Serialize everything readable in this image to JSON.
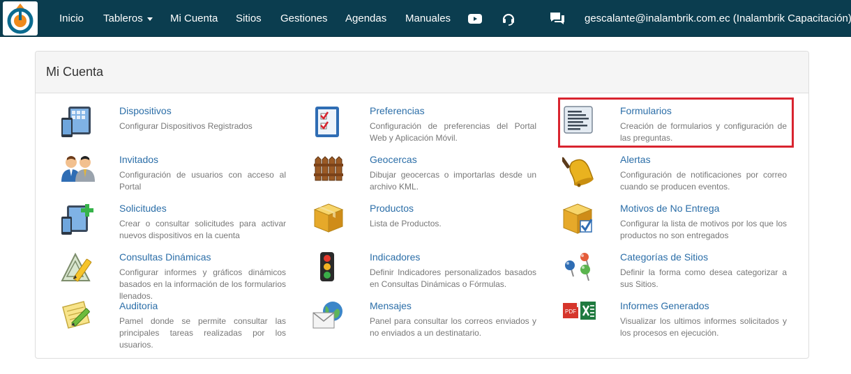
{
  "navbar": {
    "items": [
      {
        "label": "Inicio"
      },
      {
        "label": "Tableros"
      },
      {
        "label": "Mi Cuenta"
      },
      {
        "label": "Sitios"
      },
      {
        "label": "Gestiones"
      },
      {
        "label": "Agendas"
      },
      {
        "label": "Manuales"
      }
    ],
    "user_menu": "gescalante@inalambrik.com.ec (Inalambrik Capacitación)",
    "icons": [
      "youtube-icon",
      "headset-icon",
      "chat-icon"
    ]
  },
  "panel": {
    "title": "Mi Cuenta",
    "highlighted_item": "Formularios",
    "items": [
      {
        "title": "Dispositivos",
        "desc": "Configurar Dispositivos Registrados",
        "icon": "devices-icon"
      },
      {
        "title": "Preferencias",
        "desc": "Configuración de preferencias del Portal Web y Aplicación Móvil.",
        "icon": "checklist-icon"
      },
      {
        "title": "Formularios",
        "desc": "Creación de formularios y configuración de las preguntas.",
        "icon": "form-icon"
      },
      {
        "title": "Invitados",
        "desc": "Configuración de usuarios con acceso al Portal",
        "icon": "users-icon"
      },
      {
        "title": "Geocercas",
        "desc": "Dibujar geocercas o importarlas desde un archivo KML.",
        "icon": "fence-icon"
      },
      {
        "title": "Alertas",
        "desc": "Configuración de notificaciones por correo cuando se producen eventos.",
        "icon": "bell-icon"
      },
      {
        "title": "Solicitudes",
        "desc": "Crear o consultar solicitudes para activar nuevos dispositivos en la cuenta",
        "icon": "add-device-icon"
      },
      {
        "title": "Productos",
        "desc": "Lista de Productos.",
        "icon": "box-icon"
      },
      {
        "title": "Motivos de No Entrega",
        "desc": "Configurar la lista de motivos por los que los productos no son entregados",
        "icon": "box-check-icon"
      },
      {
        "title": "Consultas Dinámicas",
        "desc": "Configurar informes y gráficos dinámicos basados en la información de los formularios llenados.",
        "icon": "chart-pencil-icon"
      },
      {
        "title": "Indicadores",
        "desc": "Definir Indicadores personalizados basados en Consultas Dinámicas o Fórmulas.",
        "icon": "traffic-light-icon"
      },
      {
        "title": "Categorías de Sitios",
        "desc": "Definir la forma como desea categorizar a sus Sitios.",
        "icon": "pins-icon"
      },
      {
        "title": "Auditoria",
        "desc": "Pamel donde se permite consultar las principales tareas realizadas por los usuarios.",
        "icon": "notepad-icon"
      },
      {
        "title": "Mensajes",
        "desc": "Panel para consultar los correos enviados y no enviados a un destinatario.",
        "icon": "mail-globe-icon"
      },
      {
        "title": "Informes Generados",
        "desc": "Visualizar los ultimos informes solicitados y los procesos en ejecución.",
        "icon": "pdf-excel-icon"
      }
    ]
  },
  "colors": {
    "navbar": "#0b3d4f",
    "link": "#2b6ea8",
    "highlight": "#d9242f"
  }
}
